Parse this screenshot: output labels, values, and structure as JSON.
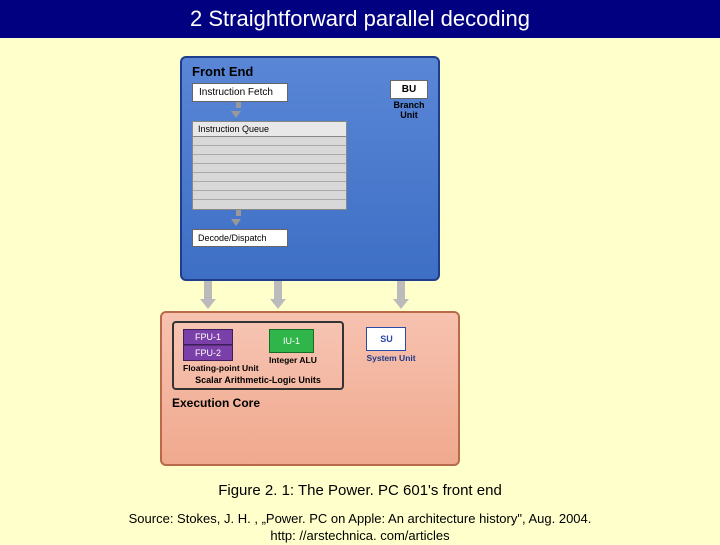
{
  "title": "2 Straightforward parallel decoding",
  "front_end": {
    "label": "Front End",
    "instruction_fetch": "Instruction Fetch",
    "bu": "BU",
    "bu_caption": "Branch Unit",
    "instruction_queue": "Instruction Queue",
    "decode": "Decode/Dispatch"
  },
  "exec_core": {
    "label": "Execution Core",
    "fpu1": "FPU-1",
    "fpu2": "FPU-2",
    "fpu_caption": "Floating-point Unit",
    "iu": "IU-1",
    "iu_caption": "Integer ALU",
    "su": "SU",
    "su_caption": "System Unit",
    "scalar_caption": "Scalar Arithmetic-Logic Units"
  },
  "figure_caption": "Figure 2. 1: The Power. PC 601's front end",
  "source_line1": "Source: Stokes, J. H. , „Power. PC on Apple: An architecture history\", Aug. 2004.",
  "source_line2": "http: //arstechnica. com/articles"
}
